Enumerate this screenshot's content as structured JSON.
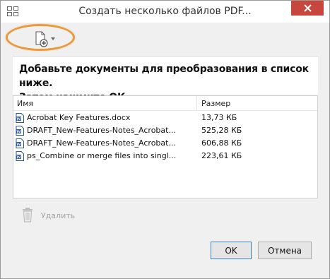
{
  "window": {
    "title": "Создать несколько файлов PDF..."
  },
  "toolbar": {
    "add_icon": "add-file-icon",
    "highlight_color": "#e89a3c"
  },
  "instruction": {
    "line1": "Добавьте документы для преобразования в список ниже.",
    "line2": "Затем нажмите ОК."
  },
  "file_list": {
    "columns": {
      "name": "Имя",
      "size": "Размер"
    },
    "rows": [
      {
        "name": "Acrobat Key Features.docx",
        "size": "13,73 КБ",
        "icon": "word-document-icon"
      },
      {
        "name": "DRAFT_New-Features-Notes_Acrobat...",
        "size": "525,28 КБ",
        "icon": "word-document-icon"
      },
      {
        "name": "DRAFT_New-Features-Notes_Acrobat...",
        "size": "606,88 КБ",
        "icon": "word-document-icon"
      },
      {
        "name": "ps_Combine or merge files into singl...",
        "size": "223,61 КБ",
        "icon": "word-document-icon"
      }
    ]
  },
  "actions": {
    "delete_label": "Удалить",
    "ok_label": "OK",
    "cancel_label": "Отмена"
  }
}
